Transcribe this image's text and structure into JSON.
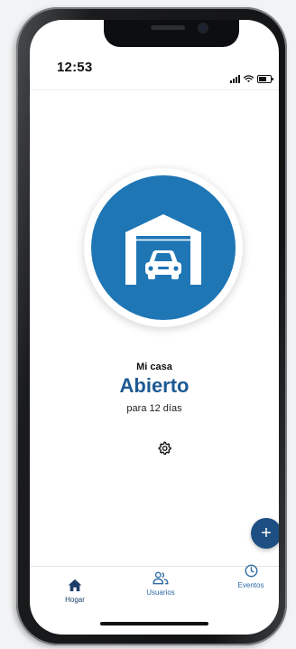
{
  "status_bar": {
    "time": "12:53",
    "icons": [
      "cellular-signal-icon",
      "wifi-icon",
      "battery-icon"
    ]
  },
  "garage": {
    "icon": "garage-car-icon",
    "name": "Mi casa",
    "state": "Abierto",
    "duration": "para 12 días",
    "settings_icon": "gear-icon",
    "accent_color": "#1e76b5"
  },
  "fab": {
    "label": "+"
  },
  "nav": {
    "items": [
      {
        "label": "Hogar",
        "icon": "home-icon",
        "active": true
      },
      {
        "label": "Usuarios",
        "icon": "users-icon",
        "active": false
      },
      {
        "label": "Eventos",
        "icon": "clock-icon",
        "active": false
      }
    ]
  },
  "colors": {
    "primary": "#1d5a94",
    "fab": "#1d4f82"
  }
}
